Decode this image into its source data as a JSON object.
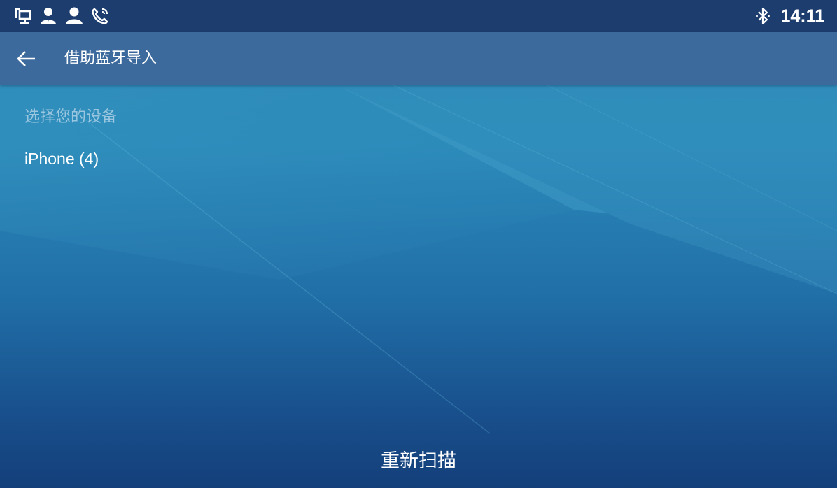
{
  "status_bar": {
    "icons": [
      "network-icon",
      "contact-icon",
      "user-icon",
      "call-icon"
    ],
    "bluetooth_icon": "bluetooth-icon",
    "time": "14:11"
  },
  "app_bar": {
    "back_icon": "back-arrow-icon",
    "title": "借助蓝牙导入"
  },
  "main": {
    "section_label": "选择您的设备",
    "devices": [
      {
        "name": "iPhone (4)"
      }
    ]
  },
  "footer": {
    "rescan_label": "重新扫描"
  },
  "colors": {
    "status_bar": "#1d3d6e",
    "app_bar": "#3d6a9c",
    "section_label": "#9ac6df",
    "text": "#ffffff"
  }
}
